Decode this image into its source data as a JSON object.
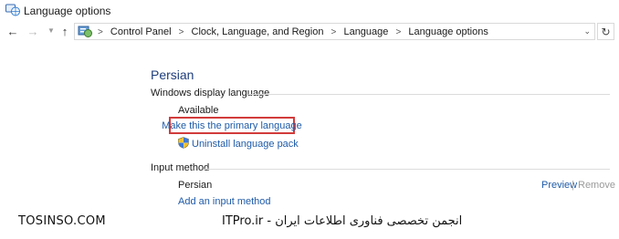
{
  "window": {
    "title": "Language options"
  },
  "nav": {
    "back_icon": "arrow-left-icon",
    "forward_icon": "arrow-right-icon",
    "up_icon": "arrow-up-icon",
    "refresh_icon": "refresh-icon",
    "dropdown_icon": "chevron-down-icon"
  },
  "breadcrumb": {
    "items": [
      "Control Panel",
      "Clock, Language, and Region",
      "Language",
      "Language options"
    ],
    "separator": ">"
  },
  "language": {
    "name": "Persian"
  },
  "display_language": {
    "heading": "Windows display language",
    "status": "Available",
    "primary_link": "Make this the primary language",
    "uninstall_link": "Uninstall language pack"
  },
  "input_method": {
    "heading": "Input method",
    "items": [
      {
        "name": "Persian",
        "preview_label": "Preview",
        "remove_label": "Remove"
      }
    ],
    "separator": "|",
    "add_link": "Add an input method"
  },
  "watermark": {
    "left": "TOSINSO.COM",
    "right": "ITPro.ir - انجمن تخصصی فناوری اطلاعات ایران"
  },
  "colors": {
    "title_blue": "#1e3d7b",
    "link_blue": "#1f5ba8",
    "highlight_red": "#d23b3b"
  }
}
